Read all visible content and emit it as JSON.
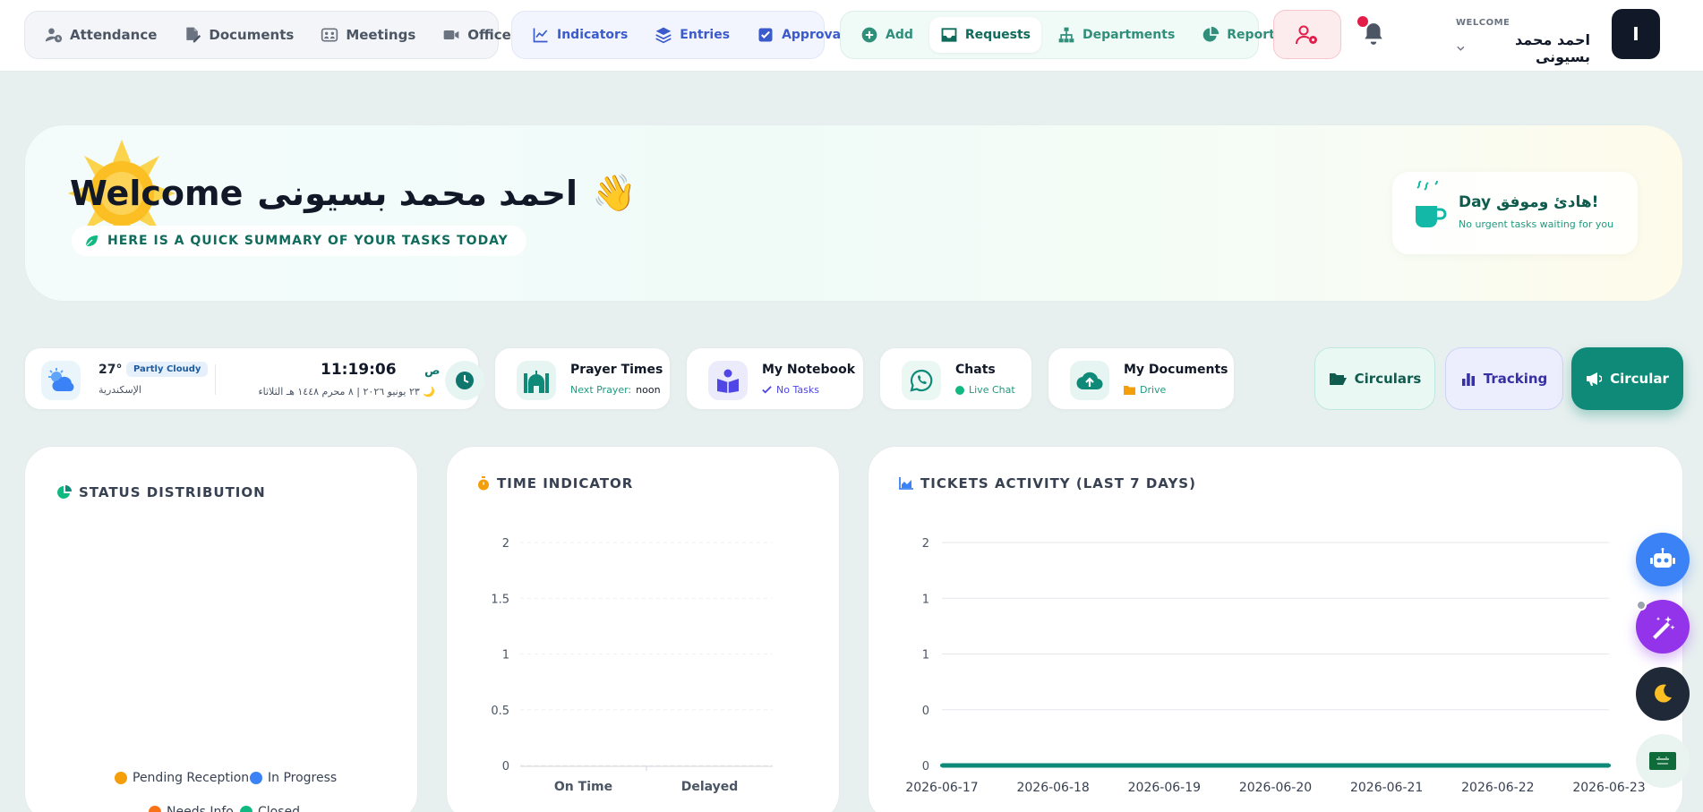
{
  "nav": {
    "group1": [
      "Attendance",
      "Documents",
      "Meetings",
      "Offices"
    ],
    "group2": [
      "Indicators",
      "Entries",
      "Approvals"
    ],
    "group3": [
      "Add",
      "Requests",
      "Departments",
      "Reports"
    ]
  },
  "user": {
    "welcome": "WELCOME",
    "name": "احمد محمد بسيونى",
    "avatar_letter": "I"
  },
  "hero": {
    "welcome_word": "Welcome",
    "name": "احمد محمد بسيونى",
    "wave": "👋",
    "subtitle": "HERE IS A QUICK SUMMARY OF YOUR TASKS TODAY",
    "day_title": "Day هادئ وموفق!",
    "day_sub": "No urgent tasks waiting for you"
  },
  "weather": {
    "temp": "27°",
    "condition": "Partly Cloudy",
    "city": "الإسكندرية",
    "time": "11:19:06",
    "ampm": "ص",
    "date_line": "🌙 ٢٣ يونيو ٢٠٢٦  |  ٨ محرم ١٤٤٨ هـ  الثلاثاء"
  },
  "widgets": {
    "prayer": {
      "title": "Prayer Times",
      "label": "Next Prayer:",
      "value": "noon"
    },
    "notebook": {
      "title": "My Notebook",
      "sub": "No Tasks"
    },
    "chats": {
      "title": "Chats",
      "sub": "Live Chat"
    },
    "docs": {
      "title": "My Documents",
      "sub": "Drive"
    }
  },
  "actions": {
    "circulars": "Circulars",
    "tracking": "Tracking",
    "circular": "Circular"
  },
  "cards": {
    "status_title": "STATUS DISTRIBUTION",
    "time_title": "TIME INDICATOR",
    "tickets_title": "TICKETS ACTIVITY (LAST 7 DAYS)"
  },
  "status_legend": [
    {
      "label": "Pending Reception",
      "color": "#f59e0b"
    },
    {
      "label": "In Progress",
      "color": "#3b82f6"
    },
    {
      "label": "Needs Info",
      "color": "#f97316"
    },
    {
      "label": "Closed",
      "color": "#10b981"
    }
  ],
  "colors": {
    "accent": "#0f8a78",
    "indigo": "#3730a3",
    "danger": "#e11d48"
  },
  "chart_data": [
    {
      "type": "bar",
      "title": "TIME INDICATOR",
      "categories": [
        "On Time",
        "Delayed"
      ],
      "values": [
        0,
        0
      ],
      "y_ticks": [
        "0",
        "0.5",
        "1",
        "1.5",
        "2"
      ],
      "ylim": [
        0,
        2
      ],
      "grid": true
    },
    {
      "type": "line",
      "title": "TICKETS ACTIVITY (LAST 7 DAYS)",
      "x": [
        "2026-06-17",
        "2026-06-18",
        "2026-06-19",
        "2026-06-20",
        "2026-06-21",
        "2026-06-22",
        "2026-06-23"
      ],
      "values": [
        0,
        0,
        0,
        0,
        0,
        0,
        0
      ],
      "y_ticks": [
        "0",
        "0",
        "1",
        "1",
        "2"
      ],
      "ylim": [
        0,
        2
      ],
      "grid": true,
      "color": "#0f8a78"
    }
  ]
}
